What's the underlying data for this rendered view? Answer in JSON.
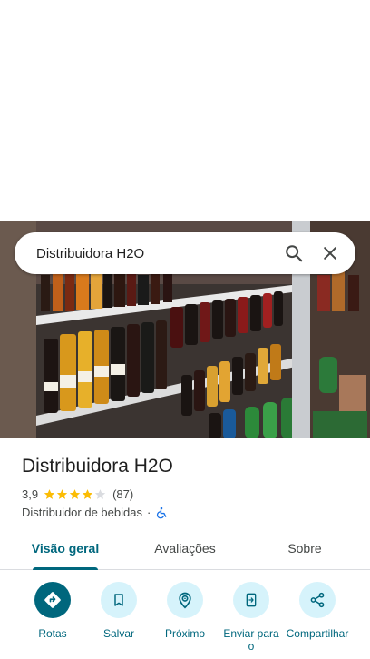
{
  "search": {
    "query": "Distribuidora H2O"
  },
  "place": {
    "name": "Distribuidora H2O",
    "rating": "3,9",
    "stars": 3.9,
    "review_count": "(87)",
    "category": "Distribuidor de bebidas",
    "separator": "·"
  },
  "tabs": [
    {
      "label": "Visão geral",
      "active": true
    },
    {
      "label": "Avaliações",
      "active": false
    },
    {
      "label": "Sobre",
      "active": false
    }
  ],
  "actions": [
    {
      "label": "Rotas",
      "icon": "directions-icon"
    },
    {
      "label": "Salvar",
      "icon": "bookmark-icon"
    },
    {
      "label": "Próximo",
      "icon": "nearby-icon"
    },
    {
      "label": "Enviar para o",
      "icon": "send-to-phone-icon"
    },
    {
      "label": "Compartilhar",
      "icon": "share-icon"
    }
  ],
  "colors": {
    "accent": "#00677d",
    "chip_bg": "#d6f3fb",
    "star": "#fbbc04",
    "accessibility": "#1a73e8"
  }
}
